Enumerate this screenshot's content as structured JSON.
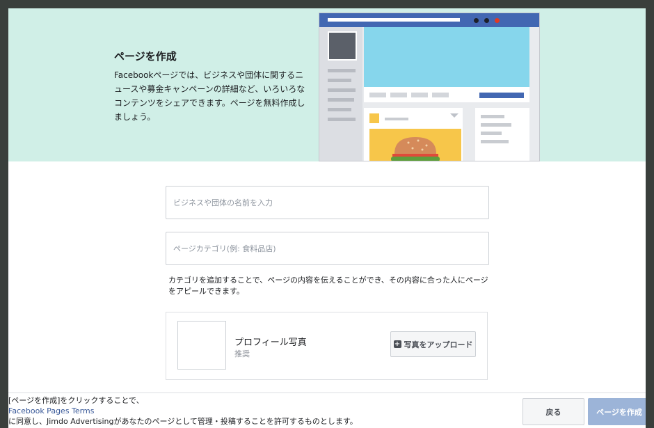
{
  "hero": {
    "title": "ページを作成",
    "description": "Facebookページでは、ビジネスや団体に関するニュースや募金キャンペーンの詳細など、いろいろなコンテンツをシェアできます。ページを無料作成しましょう。"
  },
  "form": {
    "name_placeholder": "ビジネスや団体の名前を入力",
    "category_placeholder": "ページカテゴリ(例: 食料品店)",
    "category_help": "カテゴリを追加することで、ページの内容を伝えることができ、その内容に合った人にページをアピールできます。"
  },
  "profile": {
    "title": "プロフィール写真",
    "subtitle": "推奨",
    "upload_label": "写真をアップロード"
  },
  "footer": {
    "terms_line1": "[ページを作成]をクリックすることで、",
    "terms_link": "Facebook Pages Terms",
    "terms_line3": "に同意し、Jimdo Advertisingがあなたのページとして管理・投稿することを許可するものとします。",
    "back_label": "戻る",
    "create_label": "ページを作成"
  },
  "colors": {
    "hero_bg": "#d0efe7",
    "facebook_blue": "#4267b2",
    "create_button_disabled": "#9cb4d8",
    "link": "#385898"
  }
}
